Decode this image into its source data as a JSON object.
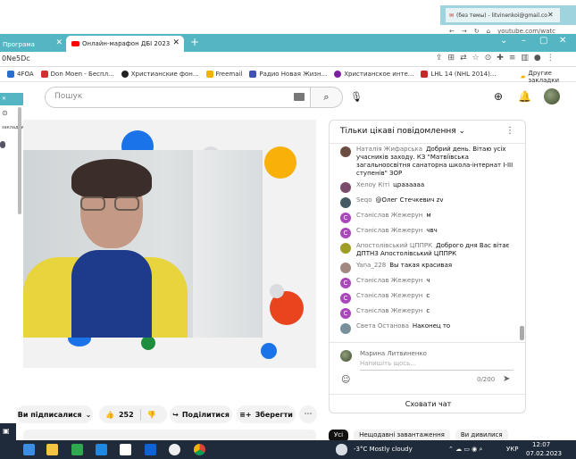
{
  "bg_window": {
    "tab_label": "(без темы) - litvinenkoi@gmail.co",
    "url": "youtube.com/watc"
  },
  "tabs": [
    {
      "label": "Програма"
    },
    {
      "label": "Онлайн-марафон ДБІ 2023"
    }
  ],
  "address": {
    "url": "0Ne5Dc"
  },
  "bookmarks": [
    {
      "label": "4FOA",
      "color": "#2b6fce"
    },
    {
      "label": "Don Moen - Беспл...",
      "color": "#d32f2f"
    },
    {
      "label": "Христианские фон...",
      "color": "#222222"
    },
    {
      "label": "Freemail",
      "color": "#f0b400"
    },
    {
      "label": "Радио Новая Жизн...",
      "color": "#3f51b5"
    },
    {
      "label": "Христианское инте...",
      "color": "#7b1fa2"
    },
    {
      "label": "LHL 14 (NHL 2014)...",
      "color": "#c62828"
    }
  ],
  "bookmarks_other": "Другие закладки",
  "search": {
    "placeholder": "Пошук"
  },
  "left_window": {
    "label": "закладки"
  },
  "actions": {
    "subscribed": "Ви підписалися",
    "likes": "252",
    "share": "Поділитися",
    "save": "Зберегти"
  },
  "chat": {
    "title": "Тільки цікаві повідомлення",
    "messages": [
      {
        "author": "Наталія Жифарська",
        "text": "Добрий день. Вітаю усіх учасників заходу. КЗ \"Матвіївська загальноосвітня санаторна школа-інтернат І-ІІІ ступенів\" ЗОР",
        "color": "#6d4c41",
        "initial": ""
      },
      {
        "author": "Хелоу Кітi",
        "text": "цраааааа",
        "color": "#7a4b6a",
        "initial": ""
      },
      {
        "author": "Seqo",
        "text": "@Олег Стечкевич zv",
        "color": "#455a64",
        "initial": ""
      },
      {
        "author": "Станіслав Жежерун",
        "text": "м",
        "color": "#ab47bc",
        "initial": "С"
      },
      {
        "author": "Станіслав Жежерун",
        "text": "чвч",
        "color": "#ab47bc",
        "initial": "С"
      },
      {
        "author": "Апостолівський ЦППРК",
        "text": "Доброго дня Вас вітає ДПТНЗ Апостолівський ЦППРК",
        "color": "#9e9d24",
        "initial": ""
      },
      {
        "author": "Yana_228",
        "text": "Вы такая красивая",
        "color": "#a1887f",
        "initial": ""
      },
      {
        "author": "Станіслав Жежерун",
        "text": "ч",
        "color": "#ab47bc",
        "initial": "С"
      },
      {
        "author": "Станіслав Жежерун",
        "text": "с",
        "color": "#ab47bc",
        "initial": "С"
      },
      {
        "author": "Станіслав Жежерун",
        "text": "с",
        "color": "#ab47bc",
        "initial": "С"
      },
      {
        "author": "Света Останова",
        "text": "Наконец то",
        "color": "#78909c",
        "initial": ""
      }
    ],
    "my_name": "Марина Литвиненко",
    "input_placeholder": "Напишіть щось...",
    "char_count": "0/200",
    "hide_label": "Сховати чат"
  },
  "chips": [
    {
      "label": "Усі",
      "active": true
    },
    {
      "label": "Нещодавні завантаження",
      "active": false
    },
    {
      "label": "Ви дивилися",
      "active": false
    }
  ],
  "taskbar": {
    "weather": "-3°C  Mostly cloudy",
    "lang": "УКР",
    "time": "12:07",
    "date": "07.02.2023"
  }
}
